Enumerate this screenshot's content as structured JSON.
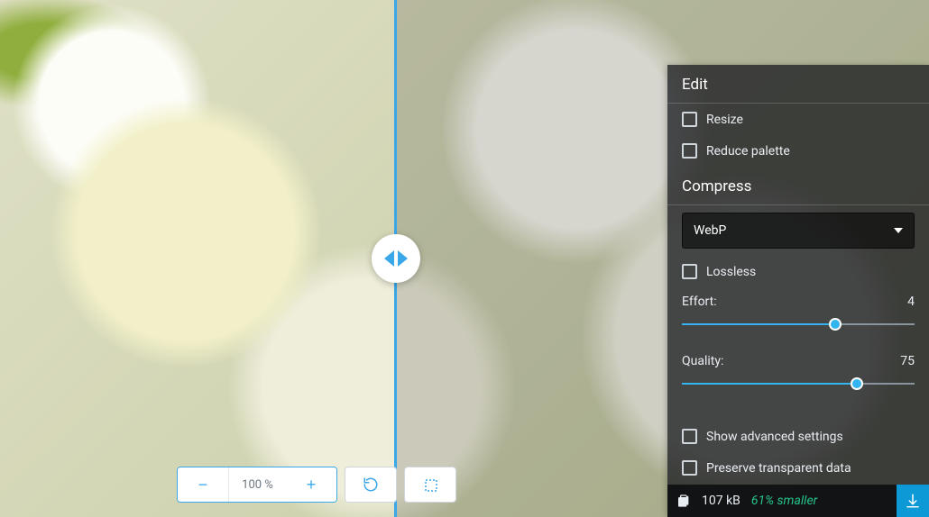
{
  "toolbar": {
    "zoom_out": "−",
    "zoom_label": "100 %",
    "zoom_in": "+"
  },
  "panel": {
    "edit_title": "Edit",
    "resize_label": "Resize",
    "reduce_palette_label": "Reduce palette",
    "compress_title": "Compress",
    "format_selected": "WebP",
    "lossless_label": "Lossless",
    "effort_label": "Effort:",
    "effort_value": "4",
    "effort_pct": 66,
    "quality_label": "Quality:",
    "quality_value": "75",
    "quality_pct": 75,
    "advanced_label": "Show advanced settings",
    "preserve_label": "Preserve transparent data"
  },
  "footer": {
    "size": "107 kB",
    "delta": "61% smaller"
  }
}
